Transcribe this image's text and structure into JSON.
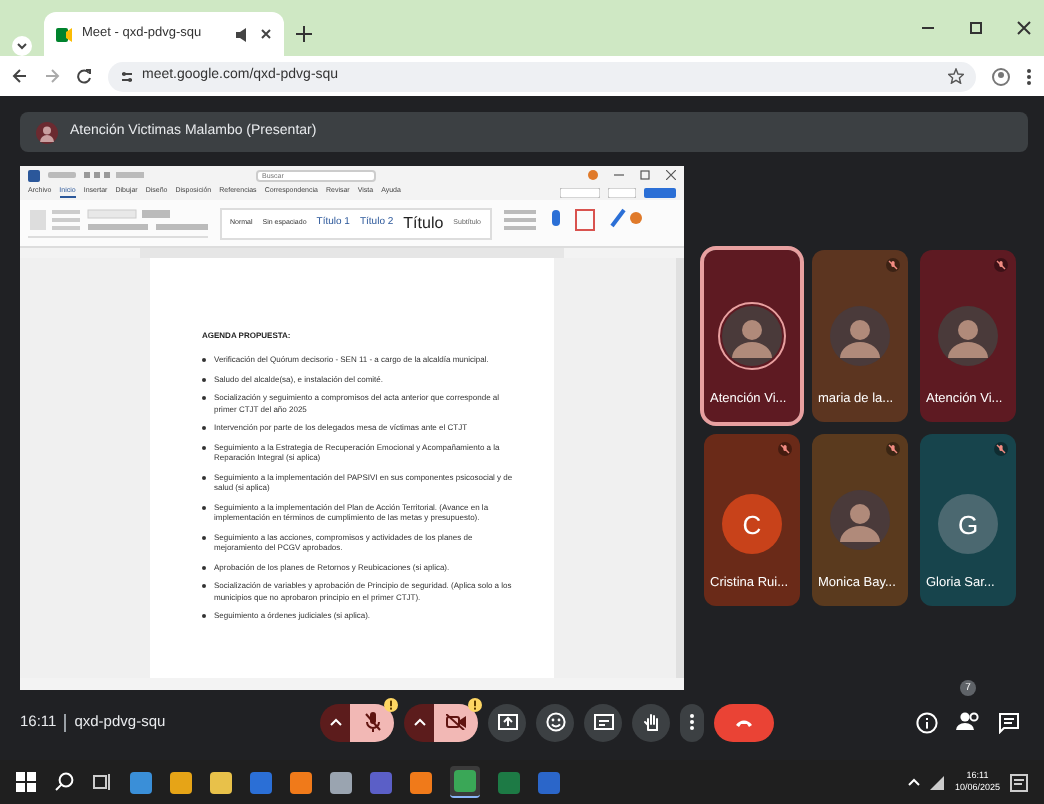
{
  "browser": {
    "tab_title": "Meet - qxd-pdvg-squ",
    "url": "meet.google.com/qxd-pdvg-squ"
  },
  "presenter_bar": {
    "title": "Atención Victimas Malambo (Presentar)"
  },
  "document": {
    "search_placeholder": "Buscar",
    "ribbon_tabs": [
      {
        "label": "Archivo",
        "selected": false
      },
      {
        "label": "Inicio",
        "selected": true
      },
      {
        "label": "Insertar",
        "selected": false
      },
      {
        "label": "Dibujar",
        "selected": false
      },
      {
        "label": "Diseño",
        "selected": false
      },
      {
        "label": "Disposición",
        "selected": false
      },
      {
        "label": "Referencias",
        "selected": false
      },
      {
        "label": "Correspondencia",
        "selected": false
      },
      {
        "label": "Revisar",
        "selected": false
      },
      {
        "label": "Vista",
        "selected": false
      },
      {
        "label": "Ayuda",
        "selected": false
      }
    ],
    "styles": [
      {
        "label": "Normal",
        "kind": "normal"
      },
      {
        "label": "Sin espaciado",
        "kind": "normal"
      },
      {
        "label": "Título 1",
        "kind": "heading"
      },
      {
        "label": "Título 2",
        "kind": "heading"
      },
      {
        "label": "Título",
        "kind": "title"
      },
      {
        "label": "Subtítulo",
        "kind": "subtitle"
      }
    ],
    "heading": "AGENDA PROPUESTA:",
    "items": [
      "Verificación del Quórum decisorio - SEN 11 - a cargo de la alcaldía municipal.",
      "Saludo del alcalde(sa), e instalación del comité.",
      "Socialización y seguimiento a compromisos del acta anterior que corresponde al primer CTJT del año 2025",
      "Intervención por parte de los delegados mesa de víctimas ante el CTJT",
      "Seguimiento a la Estrategia de Recuperación Emocional y Acompañamiento a la Reparación Integral (si aplica)",
      "Seguimiento a la implementación del PAPSIVI en sus componentes psicosocial y de salud (si aplica)",
      "Seguimiento a la implementación del Plan de Acción Territorial. (Avance en la implementación en términos de cumplimiento de las metas y presupuesto).",
      "Seguimiento a las acciones, compromisos y actividades de los planes de mejoramiento del PCGV aprobados.",
      "Aprobación de los planes de Retornos y Reubicaciones (si aplica).",
      "Socialización de variables y aprobación de Principio de seguridad. (Aplica solo a los municipios que no aprobaron principio en el primer CTJT).",
      "Seguimiento a órdenes judiciales (si aplica)."
    ]
  },
  "participants": [
    {
      "name": "Atención Vi...",
      "kind": "photo",
      "color": "#5e1a22",
      "muted": false,
      "speaking": true
    },
    {
      "name": "maria de la...",
      "kind": "photo",
      "color": "#5c3520",
      "muted": true,
      "speaking": false
    },
    {
      "name": "Atención Vi...",
      "kind": "photo",
      "color": "#5e1a22",
      "muted": true,
      "speaking": false
    },
    {
      "name": "Cristina Rui...",
      "kind": "letter",
      "avatar": {
        "letter": "C",
        "color": "#c8421a"
      },
      "color": "#6a2a18",
      "muted": true,
      "speaking": false
    },
    {
      "name": "Monica Bay...",
      "kind": "photo",
      "color": "#5a3a1e",
      "muted": true,
      "speaking": false
    },
    {
      "name": "Gloria Sar...",
      "kind": "letter",
      "avatar": {
        "letter": "G",
        "color": "#4b6870"
      },
      "color": "#17444c",
      "muted": true,
      "speaking": false
    }
  ],
  "call": {
    "time": "16:11",
    "code": "qxd-pdvg-squ",
    "mic_on": false,
    "camera_on": false,
    "people_count": "7"
  },
  "taskbar": {
    "apps": [
      {
        "color": "#3a8fd8",
        "selected": false
      },
      {
        "color": "#e6a417",
        "selected": false
      },
      {
        "color": "#e8c14a",
        "selected": false
      },
      {
        "color": "#2b6fd6",
        "selected": false
      },
      {
        "color": "#f07a1a",
        "selected": false
      },
      {
        "color": "#9aa4b0",
        "selected": false
      },
      {
        "color": "#5b5fc7",
        "selected": false
      },
      {
        "color": "#f07a1a",
        "selected": false
      },
      {
        "color": "#3aa757",
        "selected": true
      },
      {
        "color": "#1d7a45",
        "selected": false
      },
      {
        "color": "#2b66c9",
        "selected": false
      }
    ],
    "time": "16:11",
    "date": "10/06/2025"
  }
}
